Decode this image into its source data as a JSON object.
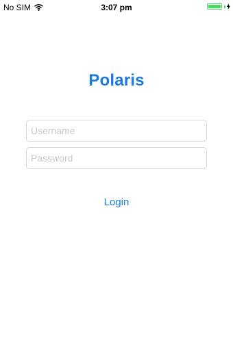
{
  "status_bar": {
    "carrier": "No SIM",
    "time": "3:07 pm",
    "wifi_icon": "wifi-icon",
    "battery_icon": "battery-icon",
    "battery_level": 1.0,
    "charging_icon": "bolt-icon",
    "battery_color": "#4cd964"
  },
  "app": {
    "title": "Polaris",
    "accent_color": "#1a7ce0"
  },
  "form": {
    "username": {
      "value": "",
      "placeholder": "Username"
    },
    "password": {
      "value": "",
      "placeholder": "Password"
    },
    "login_label": "Login"
  }
}
